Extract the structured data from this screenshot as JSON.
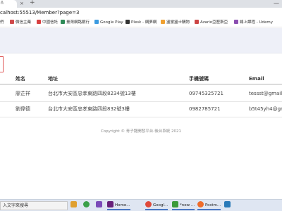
{
  "browser": {
    "tab_fragment": "ñ",
    "tab_close": "×",
    "new_tab": "+",
    "window_controls": "—",
    "url": "calhost:55513/Member?page=3"
  },
  "bookmarks": [
    {
      "label": "們",
      "color": "#555555"
    },
    {
      "label": "微信主藥",
      "color": "#d04a4a"
    },
    {
      "label": "中國信託",
      "color": "#d84040"
    },
    {
      "label": "臺灣網路銀行",
      "color": "#2e8b57"
    },
    {
      "label": "Google Play",
      "color": "#3c9be0"
    },
    {
      "label": "Plesk - 網夢網",
      "color": "#333333"
    },
    {
      "label": "盪鑾盪士購物",
      "color": "#f0a030"
    },
    {
      "label": "Azario亞歷斯亞",
      "color": "#cc4444"
    },
    {
      "label": "線上課程 - Udemy",
      "color": "#8a4db0"
    }
  ],
  "table": {
    "headers": {
      "name": "姓名",
      "address": "地址",
      "phone": "手機號碼",
      "email": "Email"
    },
    "rows": [
      {
        "name": "廖芷祥",
        "address": "台北市大安區忠孝東路四段8234號13樓",
        "phone": "09745325721",
        "email": "tessst@gmail.co"
      },
      {
        "name": "劉偉德",
        "address": "台北市大安區忠孝東路四段832號3樓",
        "phone": "0982785721",
        "email": "b5t45yh4@gmai"
      }
    ]
  },
  "footer": "Copyright © 青子龍開發平台-後台系統 2021",
  "taskbar": {
    "search_text": "入文字來搜尋",
    "items": [
      {
        "label": "",
        "color": "#e0a030"
      },
      {
        "label": "",
        "color": "#3aa04a"
      },
      {
        "label": "",
        "color": "#7a4ab8"
      },
      {
        "label": "Home...",
        "color": "#68217a"
      },
      {
        "label": "Googl...",
        "color": "#e04a3a"
      },
      {
        "label": "*new ...",
        "color": "#3a9a3a"
      },
      {
        "label": "Postm...",
        "color": "#ef6c2a"
      },
      {
        "label": "",
        "color": "#2a7ab8"
      }
    ]
  }
}
